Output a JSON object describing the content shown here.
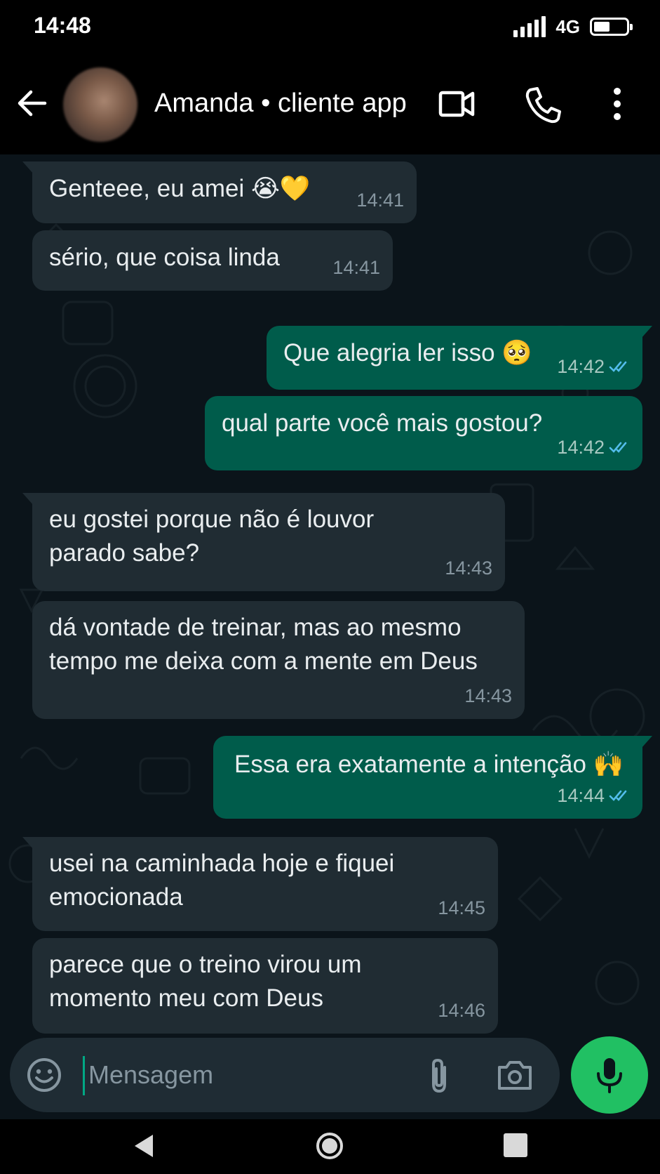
{
  "status_bar": {
    "time": "14:48",
    "network": "4G"
  },
  "header": {
    "contact_name": "Amanda • cliente app"
  },
  "messages": [
    {
      "text": "Genteee, eu amei 😭💛",
      "time": "14:41",
      "direction": "in"
    },
    {
      "text": "sério, que coisa linda",
      "time": "14:41",
      "direction": "in"
    },
    {
      "text": "Que alegria ler isso 🥺",
      "time": "14:42",
      "direction": "out"
    },
    {
      "text": "qual parte você mais gostou?",
      "time": "14:42",
      "direction": "out"
    },
    {
      "line1": "eu gostei porque não é louvor",
      "line2": "parado sabe?",
      "time": "14:43",
      "direction": "in"
    },
    {
      "line1": "dá vontade de treinar, mas ao mesmo",
      "line2": "tempo me deixa com a mente em Deus",
      "time": "14:43",
      "direction": "in"
    },
    {
      "text": "Essa era exatamente a intenção 🙌",
      "time": "14:44",
      "direction": "out"
    },
    {
      "line1": "usei na caminhada hoje e fiquei",
      "line2": "emocionada",
      "time": "14:45",
      "direction": "in"
    },
    {
      "line1": "parece que o treino virou um",
      "line2": "momento meu com Deus",
      "time": "14:46",
      "direction": "in"
    }
  ],
  "composer": {
    "placeholder": "Mensagem"
  },
  "colors": {
    "incoming_bubble": "#202c33",
    "outgoing_bubble": "#005c4b",
    "chat_background": "#0b141a",
    "read_ticks": "#53bdeb",
    "mic_button": "#21c063"
  },
  "icons": [
    "back-arrow-icon",
    "video-call-icon",
    "phone-icon",
    "more-options-icon",
    "emoji-icon",
    "attach-icon",
    "camera-icon",
    "mic-icon",
    "double-check-icon"
  ]
}
